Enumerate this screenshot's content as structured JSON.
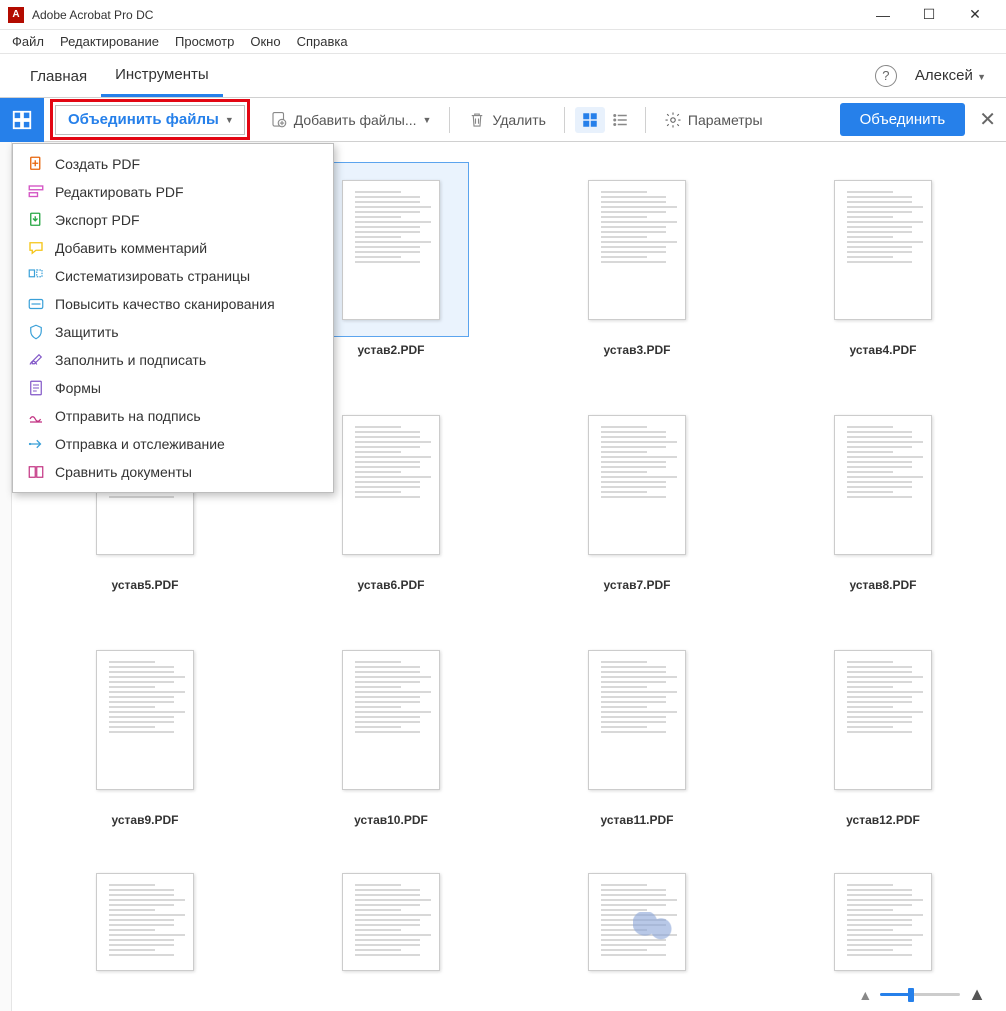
{
  "titlebar": {
    "app_title": "Adobe Acrobat Pro DC"
  },
  "menubar": {
    "file": "Файл",
    "edit": "Редактирование",
    "view": "Просмотр",
    "window": "Окно",
    "help": "Справка"
  },
  "header": {
    "tab_home": "Главная",
    "tab_tools": "Инструменты",
    "user_name": "Алексей"
  },
  "toolbar": {
    "combine_files": "Объединить файлы",
    "add_files": "Добавить файлы...",
    "delete": "Удалить",
    "options": "Параметры",
    "combine": "Объединить"
  },
  "dropdown": {
    "create_pdf": "Создать PDF",
    "edit_pdf": "Редактировать PDF",
    "export_pdf": "Экспорт PDF",
    "add_comment": "Добавить комментарий",
    "organize_pages": "Систематизировать страницы",
    "enhance_scans": "Повысить качество сканирования",
    "protect": "Защитить",
    "fill_sign": "Заполнить и подписать",
    "forms": "Формы",
    "send_signature": "Отправить на подпись",
    "send_track": "Отправка и отслеживание",
    "compare": "Сравнить документы"
  },
  "files": [
    {
      "label": ""
    },
    {
      "label": "устав2.PDF",
      "selected": true
    },
    {
      "label": "устав3.PDF"
    },
    {
      "label": "устав4.PDF"
    },
    {
      "label": "устав5.PDF"
    },
    {
      "label": "устав6.PDF"
    },
    {
      "label": "устав7.PDF"
    },
    {
      "label": "устав8.PDF"
    },
    {
      "label": "устав9.PDF"
    },
    {
      "label": "устав10.PDF"
    },
    {
      "label": "устав11.PDF"
    },
    {
      "label": "устав12.PDF"
    },
    {
      "label": ""
    },
    {
      "label": ""
    },
    {
      "label": "",
      "stamp": true
    },
    {
      "label": ""
    }
  ]
}
